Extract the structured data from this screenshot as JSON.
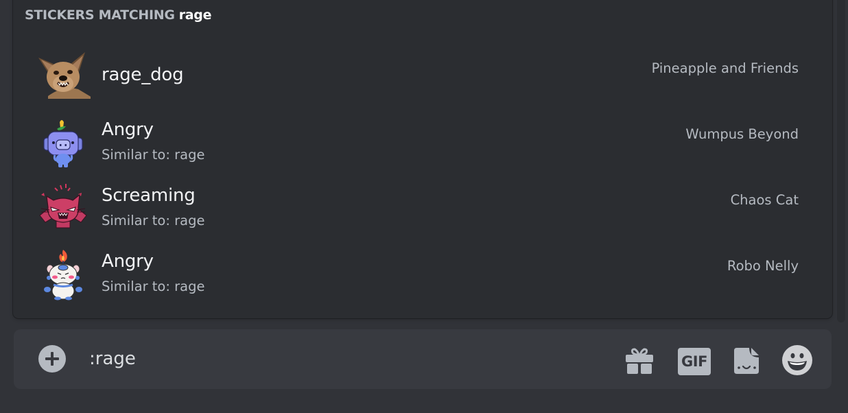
{
  "autocomplete": {
    "heading_prefix": "STICKERS MATCHING",
    "query": "rage",
    "items": [
      {
        "name": "rage_dog",
        "similar": null,
        "pack": "Pineapple and Friends",
        "sticker_icon": "angry-chihuahua-sticker"
      },
      {
        "name": "Angry",
        "similar": "Similar to: rage",
        "pack": "Wumpus Beyond",
        "sticker_icon": "wumpus-angry-sticker"
      },
      {
        "name": "Screaming",
        "similar": "Similar to: rage",
        "pack": "Chaos Cat",
        "sticker_icon": "screaming-cat-sticker"
      },
      {
        "name": "Angry",
        "similar": "Similar to: rage",
        "pack": "Robo Nelly",
        "sticker_icon": "robo-nelly-angry-sticker"
      }
    ]
  },
  "composer": {
    "value": ":rage",
    "add_icon": "plus-circle-icon",
    "buttons": [
      {
        "name": "gift",
        "icon": "gift-icon"
      },
      {
        "name": "gif",
        "label": "GIF",
        "icon": "gif-icon"
      },
      {
        "name": "sticker",
        "icon": "sticker-icon"
      },
      {
        "name": "emoji",
        "icon": "smiley-emoji-icon"
      }
    ]
  },
  "colors": {
    "page_bg": "#313338",
    "panel_bg": "#2b2d31",
    "input_bg": "#383a40",
    "muted_text": "#b5bac1",
    "primary_text": "#f2f3f5"
  }
}
